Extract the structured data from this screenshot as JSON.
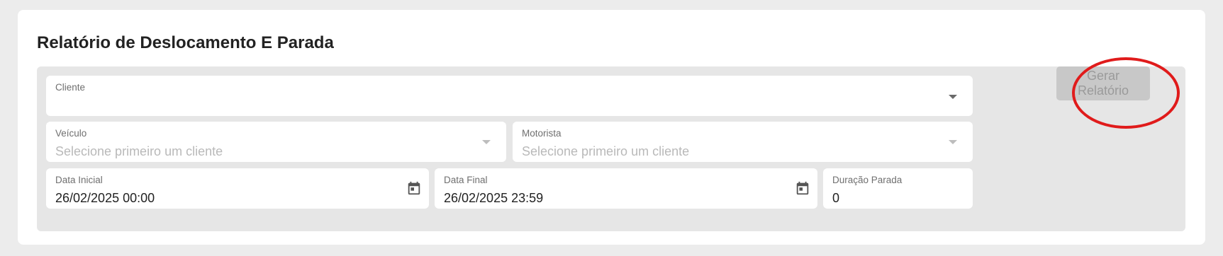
{
  "page": {
    "title": "Relatório de Deslocamento E Parada"
  },
  "form": {
    "cliente": {
      "label": "Cliente",
      "value": ""
    },
    "veiculo": {
      "label": "Veículo",
      "placeholder": "Selecione primeiro um cliente"
    },
    "motorista": {
      "label": "Motorista",
      "placeholder": "Selecione primeiro um cliente"
    },
    "data_inicial": {
      "label": "Data Inicial",
      "value": "26/02/2025 00:00"
    },
    "data_final": {
      "label": "Data Final",
      "value": "26/02/2025 23:59"
    },
    "duracao_parada": {
      "label": "Duração Parada",
      "value": "0"
    }
  },
  "actions": {
    "generate_label": "Gerar Relatório"
  },
  "icons": {
    "dropdown": "chevron-down-icon",
    "calendar": "calendar-icon"
  },
  "colors": {
    "highlight": "#e01b1b",
    "button_disabled_bg": "#c8c8c8",
    "panel_bg": "#e6e6e6"
  }
}
